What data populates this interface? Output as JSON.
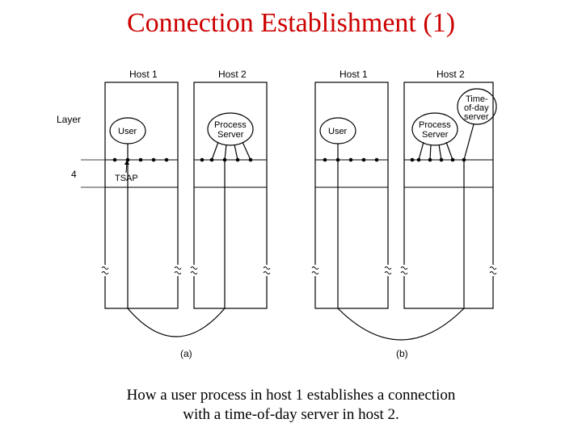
{
  "title": "Connection Establishment (1)",
  "caption_line1": "How a user process in host 1 establishes a connection",
  "caption_line2": "with a time-of-day server in host 2.",
  "labels": {
    "layer": "Layer",
    "four": "4",
    "host1": "Host 1",
    "host2": "Host 2",
    "user": "User",
    "process": "Process",
    "server": "Server",
    "tsap": "TSAP",
    "tod1": "Time-",
    "tod2": "of-day",
    "tod3": "server",
    "sub_a": "(a)",
    "sub_b": "(b)"
  }
}
